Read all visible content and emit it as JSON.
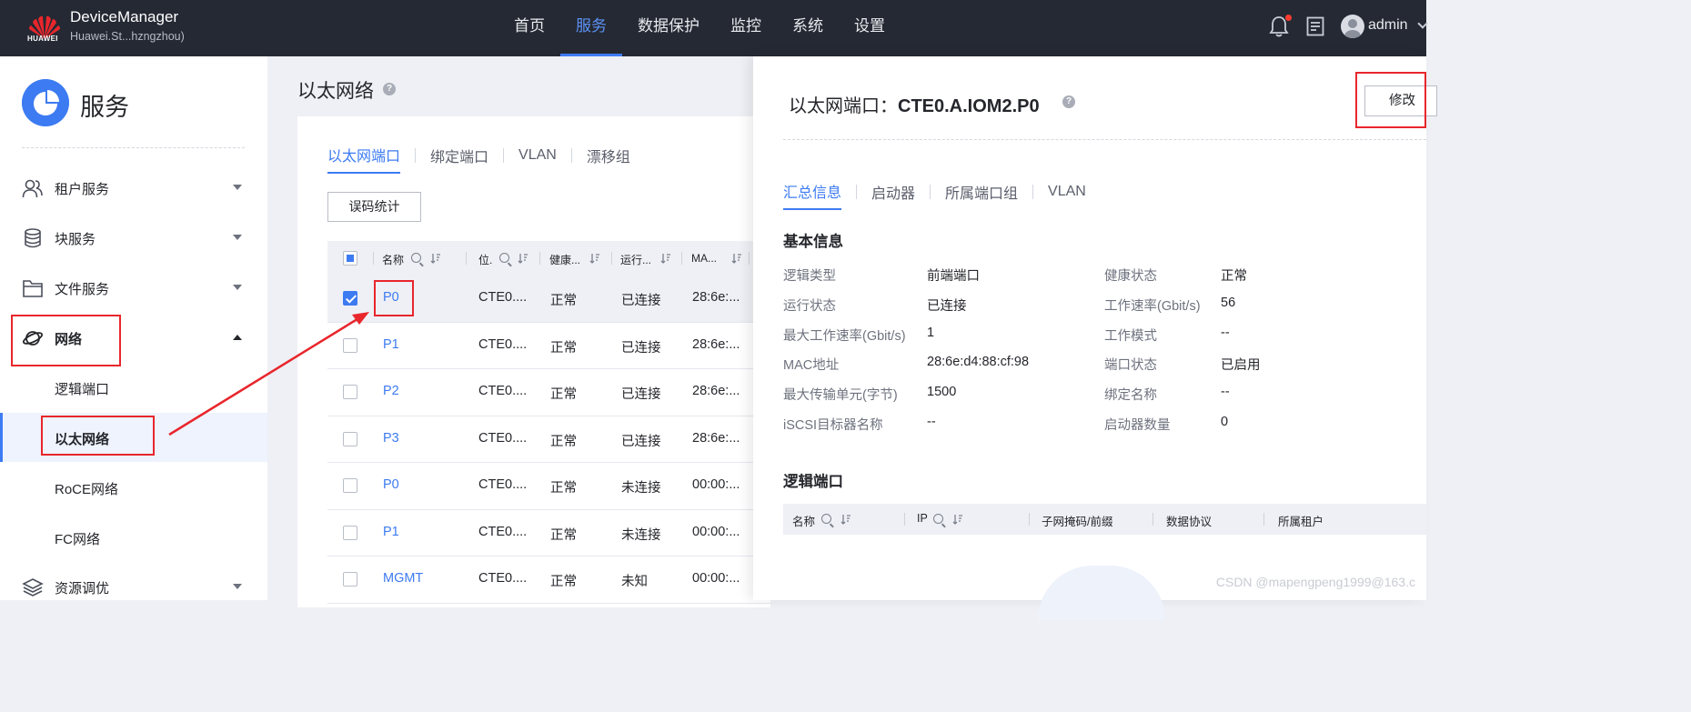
{
  "topbar": {
    "brand_word": "HUAWEI",
    "app_title": "DeviceManager",
    "device_name": "Huawei.St...hzngzhou)",
    "nav": [
      {
        "label": "首页",
        "active": false
      },
      {
        "label": "服务",
        "active": true
      },
      {
        "label": "数据保护",
        "active": false
      },
      {
        "label": "监控",
        "active": false
      },
      {
        "label": "系统",
        "active": false
      },
      {
        "label": "设置",
        "active": false
      }
    ],
    "user": "admin",
    "accent_color": "#3d7bf2"
  },
  "sidebar": {
    "title": "服务",
    "items": [
      {
        "label": "租户服务",
        "icon": "users-icon"
      },
      {
        "label": "块服务",
        "icon": "database-icon"
      },
      {
        "label": "文件服务",
        "icon": "folder-icon"
      },
      {
        "label": "网络",
        "icon": "planet-icon",
        "expanded": true
      },
      {
        "label": "资源调优",
        "icon": "layers-icon"
      }
    ],
    "network_subitems": [
      {
        "label": "逻辑端口",
        "active": false
      },
      {
        "label": "以太网络",
        "active": true
      },
      {
        "label": "RoCE网络",
        "active": false
      },
      {
        "label": "FC网络",
        "active": false
      }
    ]
  },
  "main": {
    "page_title": "以太网络",
    "tabs": [
      {
        "label": "以太网端口",
        "active": true
      },
      {
        "label": "绑定端口",
        "active": false
      },
      {
        "label": "VLAN",
        "active": false
      },
      {
        "label": "漂移组",
        "active": false
      }
    ],
    "error_stats_button": "误码统计",
    "table": {
      "columns": [
        "名称",
        "位.",
        "健康...",
        "运行...",
        "MA..."
      ],
      "rows": [
        {
          "name": "P0",
          "location": "CTE0....",
          "health": "正常",
          "running": "已连接",
          "mac": "28:6e:...",
          "selected": true
        },
        {
          "name": "P1",
          "location": "CTE0....",
          "health": "正常",
          "running": "已连接",
          "mac": "28:6e:...",
          "selected": false
        },
        {
          "name": "P2",
          "location": "CTE0....",
          "health": "正常",
          "running": "已连接",
          "mac": "28:6e:...",
          "selected": false
        },
        {
          "name": "P3",
          "location": "CTE0....",
          "health": "正常",
          "running": "已连接",
          "mac": "28:6e:...",
          "selected": false
        },
        {
          "name": "P0",
          "location": "CTE0....",
          "health": "正常",
          "running": "未连接",
          "mac": "00:00:...",
          "selected": false
        },
        {
          "name": "P1",
          "location": "CTE0....",
          "health": "正常",
          "running": "未连接",
          "mac": "00:00:...",
          "selected": false
        },
        {
          "name": "MGMT",
          "location": "CTE0....",
          "health": "正常",
          "running": "未知",
          "mac": "00:00:...",
          "selected": false
        }
      ]
    }
  },
  "detail": {
    "title_prefix": "以太网端口：",
    "title_name": "CTE0.A.IOM2.P0",
    "edit_button": "修改",
    "tabs": [
      {
        "label": "汇总信息",
        "active": true
      },
      {
        "label": "启动器",
        "active": false
      },
      {
        "label": "所属端口组",
        "active": false
      },
      {
        "label": "VLAN",
        "active": false
      }
    ],
    "basic_info_title": "基本信息",
    "basic_info_left": [
      {
        "key": "逻辑类型",
        "value": "前端端口"
      },
      {
        "key": "运行状态",
        "value": "已连接"
      },
      {
        "key": "最大工作速率(Gbit/s)",
        "value": "1"
      },
      {
        "key": "MAC地址",
        "value": "28:6e:d4:88:cf:98"
      },
      {
        "key": "最大传输单元(字节)",
        "value": "1500"
      },
      {
        "key": "iSCSI目标器名称",
        "value": "--"
      }
    ],
    "basic_info_right": [
      {
        "key": "健康状态",
        "value": "正常"
      },
      {
        "key": "工作速率(Gbit/s)",
        "value": "56"
      },
      {
        "key": "工作模式",
        "value": "--"
      },
      {
        "key": "端口状态",
        "value": "已启用"
      },
      {
        "key": "绑定名称",
        "value": "--"
      },
      {
        "key": "启动器数量",
        "value": "0"
      }
    ],
    "logical_ports_title": "逻辑端口",
    "logical_ports_columns": [
      "名称",
      "IP",
      "子网掩码/前缀",
      "数据协议",
      "所属租户"
    ]
  },
  "watermark": "CSDN @mapengpeng1999@163.c",
  "annotation_color": "#e8262c"
}
